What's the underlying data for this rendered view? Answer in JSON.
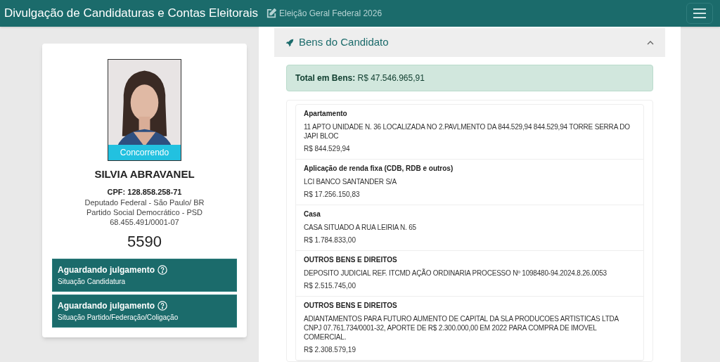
{
  "header": {
    "title": "Divulgação de Candidaturas e Contas Eleitorais",
    "election": "Eleição Geral Federal 2026"
  },
  "candidate": {
    "status_badge": "Concorrendo",
    "name": "SILVIA ABRAVANEL",
    "cpf": "CPF: 128.858.258-71",
    "office": "Deputado Federal - São Paulo/ BR",
    "party": "Partido Social Democrático - PSD",
    "cnpj": "68.455.491/0001-07",
    "number": "5590",
    "situations": [
      {
        "status": "Aguardando julgamento",
        "label": "Situação Candidatura"
      },
      {
        "status": "Aguardando julgamento",
        "label": "Situação Partido/Federação/Coligação"
      }
    ]
  },
  "assets": {
    "title": "Bens do Candidato",
    "expanded": true,
    "total_label": "Total em Bens:",
    "total_value": "R$ 47.546.965,91",
    "items": [
      {
        "type": "Apartamento",
        "description": "11 APTO UNIDADE N. 36 LOCALIZADA NO 2.PAVLMENTO DA 844.529,94 844.529,94 TORRE SERRA DO JAPI BLOC",
        "value": "R$ 844.529,94"
      },
      {
        "type": "Aplicação de renda fixa (CDB, RDB e outros)",
        "description": "LCI BANCO SANTANDER S/A",
        "value": "R$ 17.256.150,83"
      },
      {
        "type": "Casa",
        "description": "CASA SITUADO A RUA LEIRIA N. 65",
        "value": "R$ 1.784.833,00"
      },
      {
        "type": "OUTROS BENS E DIREITOS",
        "description": "DEPOSITO JUDICIAL REF. ITCMD AÇÃO ORDINARIA PROCESSO Nº 1098480-94.2024.8.26.0053",
        "value": "R$ 2.515.745,00"
      },
      {
        "type": "OUTROS BENS E DIREITOS",
        "description": "ADIANTAMENTOS PARA FUTURO AUMENTO DE CAPITAL DA SLA PRODUCOES ARTISTICAS LTDA CNPJ 07.761.734/0001-32, APORTE DE R$ 2.300.000,00 EM 2022 PARA COMPRA DE IMOVEL COMERCIAL.",
        "value": "R$ 2.308.579,19"
      }
    ]
  }
}
